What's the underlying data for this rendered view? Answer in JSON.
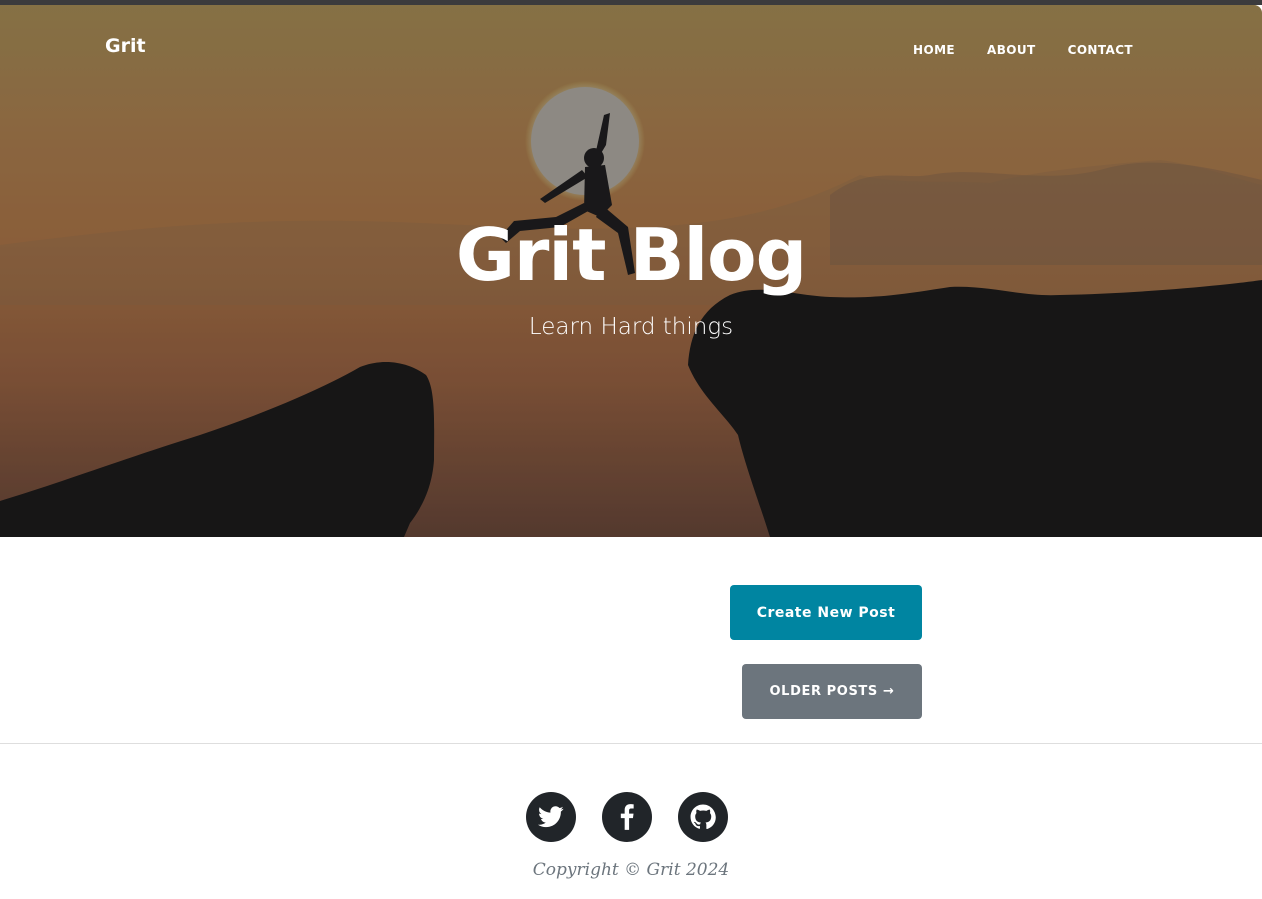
{
  "navbar": {
    "brand": "Grit",
    "links": [
      {
        "label": "HOME"
      },
      {
        "label": "ABOUT"
      },
      {
        "label": "CONTACT"
      }
    ]
  },
  "hero": {
    "title": "Grit Blog",
    "subtitle": "Learn Hard things"
  },
  "main": {
    "create_button_label": "Create New Post",
    "older_posts_label": "OLDER POSTS →"
  },
  "footer": {
    "social": [
      {
        "icon": "twitter-icon"
      },
      {
        "icon": "facebook-icon"
      },
      {
        "icon": "github-icon"
      }
    ],
    "copyright": "Copyright © Grit 2024"
  },
  "colors": {
    "primary": "#0085a1",
    "secondary": "#6c757d",
    "dark": "#212529"
  }
}
